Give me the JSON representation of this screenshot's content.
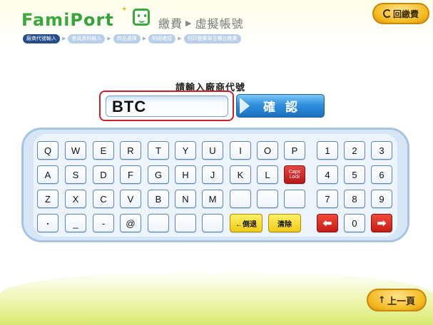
{
  "header": {
    "logo_text_a": "Fami",
    "logo_text_b": "Port",
    "title_part1": "繳費",
    "title_arrow": "▶",
    "title_part2": "虛擬帳號",
    "return_label": "回繳費"
  },
  "breadcrumb": {
    "steps": [
      "廠商代號輸入",
      "會員資料輸入",
      "商品選擇",
      "明細確認",
      "列印繳費單至櫃台繳費"
    ],
    "active_index": 0
  },
  "form": {
    "prompt": "請輸入廠商代號",
    "input_value": "BTC",
    "confirm_label": "確認"
  },
  "keyboard": {
    "row1": [
      "Q",
      "W",
      "E",
      "R",
      "T",
      "Y",
      "U",
      "I",
      "O",
      "P"
    ],
    "row2": [
      "A",
      "S",
      "D",
      "F",
      "G",
      "H",
      "J",
      "K",
      "L"
    ],
    "caps_line1": "Caps",
    "caps_line2": "Lock",
    "row3": [
      "Z",
      "X",
      "C",
      "V",
      "B",
      "N",
      "M"
    ],
    "row4": [
      "·",
      "_",
      "-",
      "@"
    ],
    "backspace_label": "←倒退",
    "clear_label": "清除",
    "numpad": [
      "1",
      "2",
      "3",
      "4",
      "5",
      "6",
      "7",
      "8",
      "9",
      "0"
    ],
    "left_arrow": "⬅",
    "right_arrow": "➡"
  },
  "footer": {
    "prev_label": "上一頁",
    "prev_arrow": "↑"
  },
  "colors": {
    "brand_green": "#3aa83a",
    "active_crumb": "#244d8a",
    "confirm_blue": "#2f8fde",
    "highlight_red": "#c8202e",
    "gold_button": "#f3b81e"
  }
}
